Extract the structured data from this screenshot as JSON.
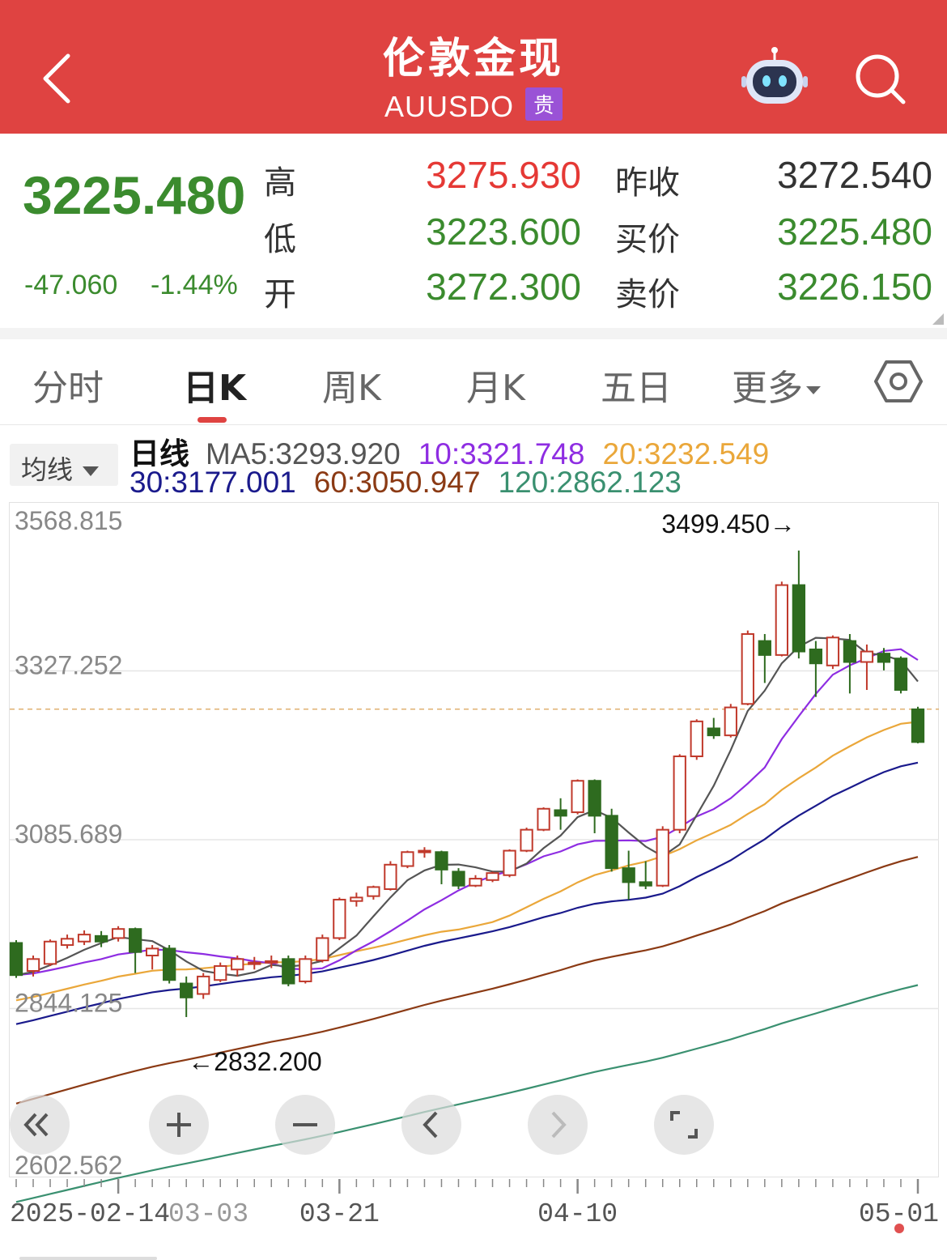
{
  "header": {
    "title": "伦敦金现",
    "code": "AUUSDO",
    "badge": "贵",
    "back_icon": "chevron-left-icon",
    "robot_icon": "robot-assistant-icon",
    "search_icon": "search-icon",
    "bg_color": "#df4341"
  },
  "quote": {
    "price": "3225.480",
    "change": "-47.060",
    "change_pct": "-1.44%",
    "high_label": "高",
    "high": "3275.930",
    "low_label": "低",
    "low": "3223.600",
    "open_label": "开",
    "open": "3272.300",
    "prev_close_label": "昨收",
    "prev_close": "3272.540",
    "bid_label": "买价",
    "bid": "3225.480",
    "ask_label": "卖价",
    "ask": "3226.150",
    "up_color": "#e53935",
    "down_color": "#3b8b2e"
  },
  "tabs": [
    {
      "label": "分时"
    },
    {
      "label": "日K",
      "active": true
    },
    {
      "label": "周K"
    },
    {
      "label": "月K"
    },
    {
      "label": "五日"
    },
    {
      "label": "更多"
    }
  ],
  "settings_icon": "hexagon-settings-icon",
  "indicator": {
    "selector_label": "均线",
    "period_label": "日线",
    "ma5": "MA5:3293.920",
    "ma10": "10:3321.748",
    "ma20": "20:3232.549",
    "ma30": "30:3177.001",
    "ma60": "60:3050.947",
    "ma120": "120:2862.123",
    "ma_colors": {
      "ma5": "#555555",
      "ma10": "#8e2de2",
      "ma20": "#eaa73a",
      "ma30": "#1a1a8c",
      "ma60": "#8b3a14",
      "ma120": "#3a9070"
    }
  },
  "chart_data": {
    "type": "candlestick",
    "period": "daily",
    "y_ticks": [
      "3568.815",
      "3327.252",
      "3085.689",
      "2844.125",
      "2602.562"
    ],
    "ylim": [
      2602.562,
      3568.815
    ],
    "x_labels": [
      "2025-02-14",
      "03-03",
      "03-21",
      "04-10",
      "05-01"
    ],
    "annotations": {
      "max": "3499.450→",
      "min": "←2832.200"
    },
    "reference_price": 3272.54,
    "candles": [
      [
        2938,
        2892,
        2942,
        2888
      ],
      [
        2898,
        2915,
        2920,
        2890
      ],
      [
        2908,
        2940,
        2943,
        2905
      ],
      [
        2935,
        2944,
        2950,
        2930
      ],
      [
        2940,
        2950,
        2956,
        2935
      ],
      [
        2948,
        2940,
        2955,
        2932
      ],
      [
        2945,
        2958,
        2962,
        2940
      ],
      [
        2958,
        2925,
        2960,
        2895
      ],
      [
        2920,
        2930,
        2935,
        2900
      ],
      [
        2930,
        2885,
        2935,
        2880
      ],
      [
        2880,
        2860,
        2890,
        2832
      ],
      [
        2865,
        2890,
        2895,
        2858
      ],
      [
        2885,
        2905,
        2910,
        2882
      ],
      [
        2900,
        2915,
        2920,
        2890
      ],
      [
        2908,
        2910,
        2918,
        2900
      ],
      [
        2910,
        2912,
        2920,
        2902
      ],
      [
        2915,
        2880,
        2920,
        2876
      ],
      [
        2883,
        2915,
        2920,
        2880
      ],
      [
        2913,
        2945,
        2950,
        2910
      ],
      [
        2945,
        3000,
        3003,
        2942
      ],
      [
        2998,
        3003,
        3010,
        2990
      ],
      [
        3005,
        3018,
        3020,
        3000
      ],
      [
        3015,
        3050,
        3055,
        3013
      ],
      [
        3048,
        3068,
        3070,
        3045
      ],
      [
        3068,
        3070,
        3075,
        3060
      ],
      [
        3068,
        3043,
        3070,
        3022
      ],
      [
        3040,
        3020,
        3045,
        3015
      ],
      [
        3020,
        3030,
        3035,
        3018
      ],
      [
        3028,
        3038,
        3040,
        3025
      ],
      [
        3035,
        3070,
        3072,
        3032
      ],
      [
        3070,
        3100,
        3103,
        3068
      ],
      [
        3100,
        3130,
        3132,
        3098
      ],
      [
        3128,
        3120,
        3145,
        3100
      ],
      [
        3125,
        3170,
        3172,
        3122
      ],
      [
        3170,
        3120,
        3172,
        3095
      ],
      [
        3120,
        3045,
        3130,
        3040
      ],
      [
        3045,
        3025,
        3070,
        3000
      ],
      [
        3025,
        3020,
        3055,
        3015
      ],
      [
        3020,
        3100,
        3105,
        3018
      ],
      [
        3100,
        3205,
        3208,
        3095
      ],
      [
        3205,
        3255,
        3258,
        3200
      ],
      [
        3245,
        3235,
        3260,
        3230
      ],
      [
        3235,
        3275,
        3280,
        3232
      ],
      [
        3280,
        3380,
        3385,
        3278
      ],
      [
        3370,
        3350,
        3380,
        3310
      ],
      [
        3350,
        3450,
        3455,
        3348
      ],
      [
        3450,
        3355,
        3499.45,
        3345
      ],
      [
        3358,
        3338,
        3370,
        3290
      ],
      [
        3335,
        3375,
        3378,
        3330
      ],
      [
        3370,
        3340,
        3380,
        3295
      ],
      [
        3340,
        3355,
        3365,
        3300
      ],
      [
        3352,
        3340,
        3360,
        3328
      ],
      [
        3345,
        3300,
        3348,
        3295
      ],
      [
        3272.3,
        3225.48,
        3275.93,
        3223.6
      ]
    ]
  },
  "controls": [
    {
      "name": "scroll-left-fast-icon"
    },
    {
      "name": "zoom-in-icon"
    },
    {
      "name": "zoom-out-icon"
    },
    {
      "name": "chevron-left-icon"
    },
    {
      "name": "chevron-right-icon"
    },
    {
      "name": "fullscreen-icon"
    }
  ]
}
